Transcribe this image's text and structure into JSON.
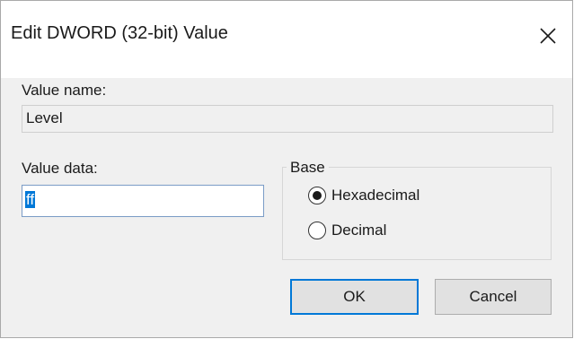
{
  "dialog": {
    "title": "Edit DWORD (32-bit) Value",
    "close_icon": "close-icon"
  },
  "value_name": {
    "label": "Value name:",
    "value": "Level"
  },
  "value_data": {
    "label": "Value data:",
    "value": "ff"
  },
  "base": {
    "legend": "Base",
    "options": [
      {
        "label": "Hexadecimal",
        "selected": true
      },
      {
        "label": "Decimal",
        "selected": false
      }
    ]
  },
  "buttons": {
    "ok_label": "OK",
    "cancel_label": "Cancel"
  },
  "colors": {
    "accent": "#0078d7",
    "dialog_background": "#f0f0f0"
  }
}
